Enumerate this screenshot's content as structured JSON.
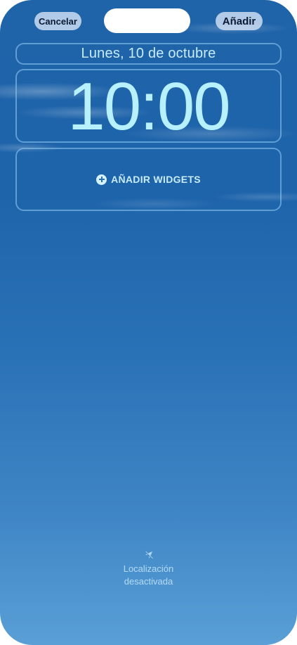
{
  "header": {
    "cancel_label": "Cancelar",
    "add_label": "Añadir"
  },
  "lock_screen": {
    "date": "Lunes, 10 de octubre",
    "time": "10:00",
    "widgets_label": "AÑADIR WIDGETS"
  },
  "footer": {
    "location_line1": "Localización",
    "location_line2": "desactivada",
    "location_icon": "location-off-icon"
  },
  "colors": {
    "background_top": "#1f63a8",
    "background_bottom": "#5a9fd6",
    "time_color": "#b7f0ff",
    "frame_border": "#96cdf5"
  }
}
